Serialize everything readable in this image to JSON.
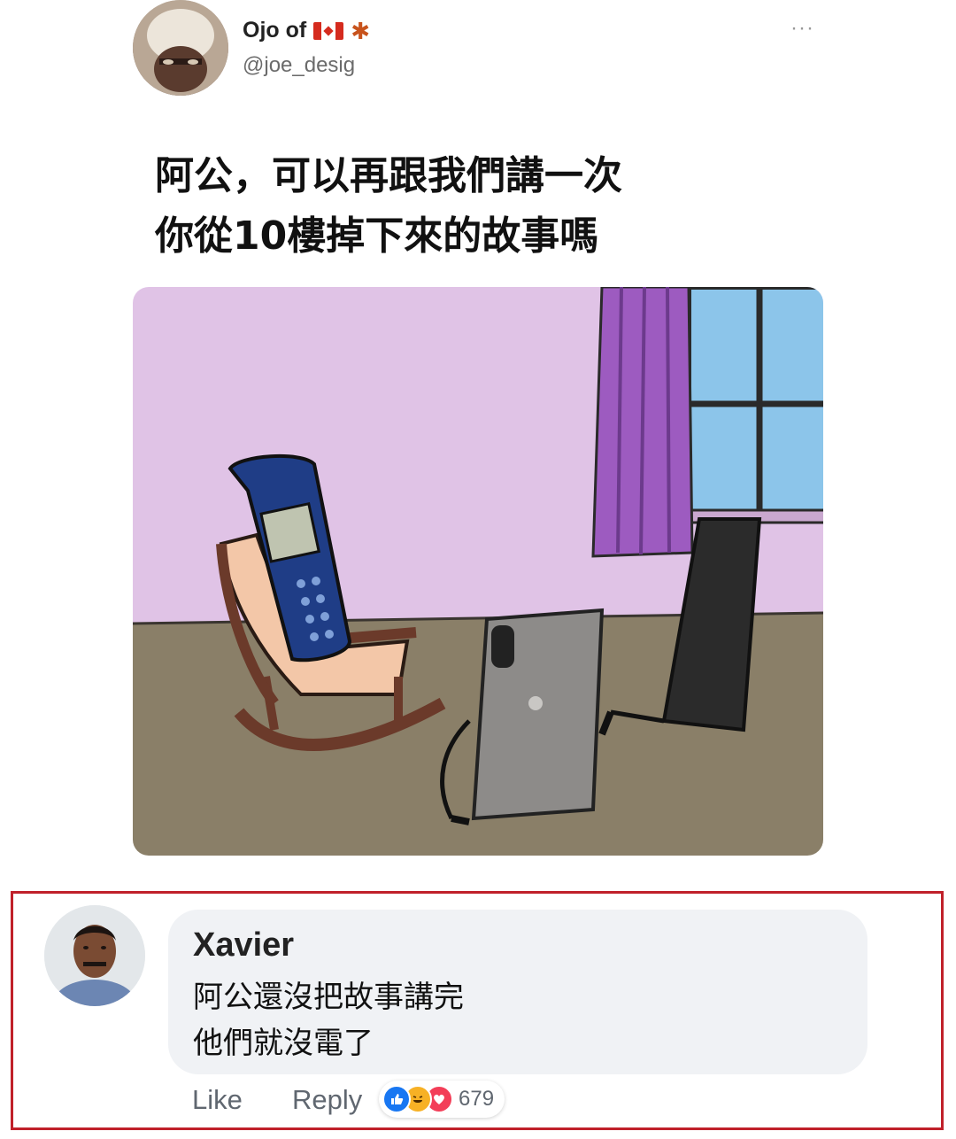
{
  "post": {
    "author_name": "Ojo of",
    "author_handle": "@joe_desig",
    "more_label": "···",
    "text_lines": [
      "阿公，可以再跟我們講一次",
      "你從10樓掉下來的故事嗎"
    ]
  },
  "comment": {
    "name": "Xavier",
    "text_lines": [
      "阿公還沒把故事講完",
      "他們就沒電了"
    ],
    "like_label": "Like",
    "reply_label": "Reply",
    "reaction_count": "679"
  },
  "colors": {
    "frame": "#c0202a",
    "bubble": "#f0f2f5",
    "like": "#1877f2",
    "haha": "#f7b125",
    "love": "#f33e58"
  }
}
